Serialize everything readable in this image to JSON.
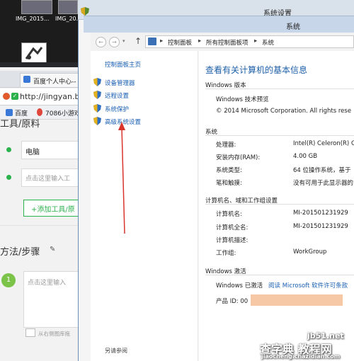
{
  "desktop": {
    "icons": [
      {
        "label": "IMG_2015..."
      },
      {
        "label": "IMG_20..."
      }
    ]
  },
  "browser": {
    "tab_title": "百度个人中心--",
    "url": "http://jingyan.b",
    "favorites": [
      {
        "label": "百度"
      },
      {
        "label": "7086小游戏"
      }
    ],
    "tools_heading": "工具/原料",
    "tool_value": "电脑",
    "tool_placeholder": "点击这里输入工",
    "add_tool_button": "+添加工具/原",
    "steps_heading": "方法/步骤",
    "step_number": "1",
    "step_placeholder": "点击这里输入",
    "upload_hint": "从右侧图库拖"
  },
  "window": {
    "outer_title": "系统设置",
    "inner_title": "系统",
    "breadcrumb": [
      "控制面板",
      "所有控制面板项",
      "系统"
    ]
  },
  "sidebar": {
    "home_link": "控制面板主页",
    "items": [
      {
        "label": "设备管理器"
      },
      {
        "label": "远程设置"
      },
      {
        "label": "系统保护"
      },
      {
        "label": "高级系统设置"
      }
    ],
    "see_also": "另请参阅"
  },
  "main": {
    "page_title": "查看有关计算机的基本信息",
    "edition_section": "Windows 版本",
    "edition_name": "Windows 技术预览",
    "copyright": "© 2014 Microsoft Corporation. All rights rese",
    "system_section": "系统",
    "system_rows": [
      {
        "label": "处理器:",
        "value": "Intel(R) Celeron(R) C"
      },
      {
        "label": "安装内存(RAM):",
        "value": "4.00 GB"
      },
      {
        "label": "系统类型:",
        "value": "64 位操作系统，基于"
      },
      {
        "label": "笔和触摸:",
        "value": "没有可用于此显示器的"
      }
    ],
    "computer_section": "计算机名、域和工作组设置",
    "computer_rows": [
      {
        "label": "计算机名:",
        "value": "MI-201501231929"
      },
      {
        "label": "计算机全名:",
        "value": "MI-201501231929"
      },
      {
        "label": "计算机描述:",
        "value": ""
      },
      {
        "label": "工作组:",
        "value": "WorkGroup"
      }
    ],
    "activation_section": "Windows 激活",
    "activation_status": "Windows 已激活",
    "license_link": "阅读 Microsoft 软件许可条款",
    "product_id_label": "产品 ID: 00"
  },
  "watermark": {
    "site": "jb51.net",
    "brand": "查字典 教程网",
    "url": "jiaocheng.chazidian.com"
  },
  "colors": {
    "link": "#1a5fb4",
    "arrow": "#d9342b",
    "title_bar": "#c7d6e8",
    "green": "#2bb24c"
  }
}
